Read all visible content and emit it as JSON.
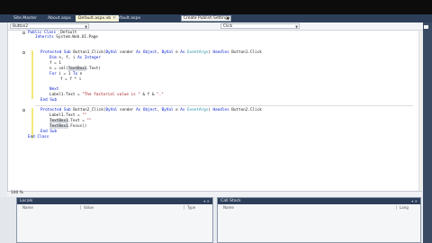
{
  "tabs": [
    {
      "label": "Site.Master",
      "active": false
    },
    {
      "label": "About.aspx",
      "active": false
    },
    {
      "label": "Default.aspx.vb",
      "active": true
    },
    {
      "label": "Default.aspx",
      "active": false
    }
  ],
  "build_config": "Create Publish Settings",
  "properties_label": "Prope",
  "nav": {
    "left": "Button2",
    "right": "Click"
  },
  "code": {
    "l1": [
      "Public Class",
      " _Default"
    ],
    "l2": [
      "Inherits",
      " System.Web.UI.Page"
    ],
    "l3": [
      "Protected Sub",
      " Button1_Click(",
      "ByVal",
      " sender ",
      "As Object",
      ", ",
      "ByVal",
      " e ",
      "As",
      " ",
      "EventArgs",
      ") ",
      "Handles",
      " Button1.Click"
    ],
    "l4": [
      "Dim",
      " n, f, i ",
      "As Integer"
    ],
    "l5": [
      "f = 1"
    ],
    "l6": [
      "n = val(",
      "TextBox1",
      ".Text)"
    ],
    "l7": [
      "For",
      " i = 1 ",
      "To",
      " n"
    ],
    "l8": [
      "f = f * i"
    ],
    "l9": [
      "Next"
    ],
    "l10": [
      "Label1.Text = ",
      "\"The factorial value is \"",
      " & f & ",
      "\".\""
    ],
    "l11": [
      "End Sub"
    ],
    "l12": [
      "Protected Sub",
      " Button2_Click(",
      "ByVal",
      " sender ",
      "As Object",
      ", ",
      "ByVal",
      " e ",
      "As",
      " ",
      "EventArgs",
      ") ",
      "Handles",
      " Button2.Click"
    ],
    "l13": [
      "Label1.Text = ",
      "\"\""
    ],
    "l14": [
      "TextBox1",
      ".Text = ",
      "\"\""
    ],
    "l15": [
      "TextBox1",
      ".Focus()"
    ],
    "l16": [
      "End Sub"
    ],
    "l17": [
      "End Class"
    ]
  },
  "zoom": "100 %",
  "panels": {
    "locals": {
      "title": "Locals",
      "cols": [
        "Name",
        "Value",
        "Type"
      ]
    },
    "callstack": {
      "title": "Call Stack",
      "cols": [
        "Name",
        "Lang"
      ]
    }
  },
  "colors": {
    "tab_strip": "#2d3e59",
    "active_tab": "#f7f3d4",
    "keyword": "#0018cc",
    "type": "#1f8fa6",
    "string": "#a31515"
  }
}
